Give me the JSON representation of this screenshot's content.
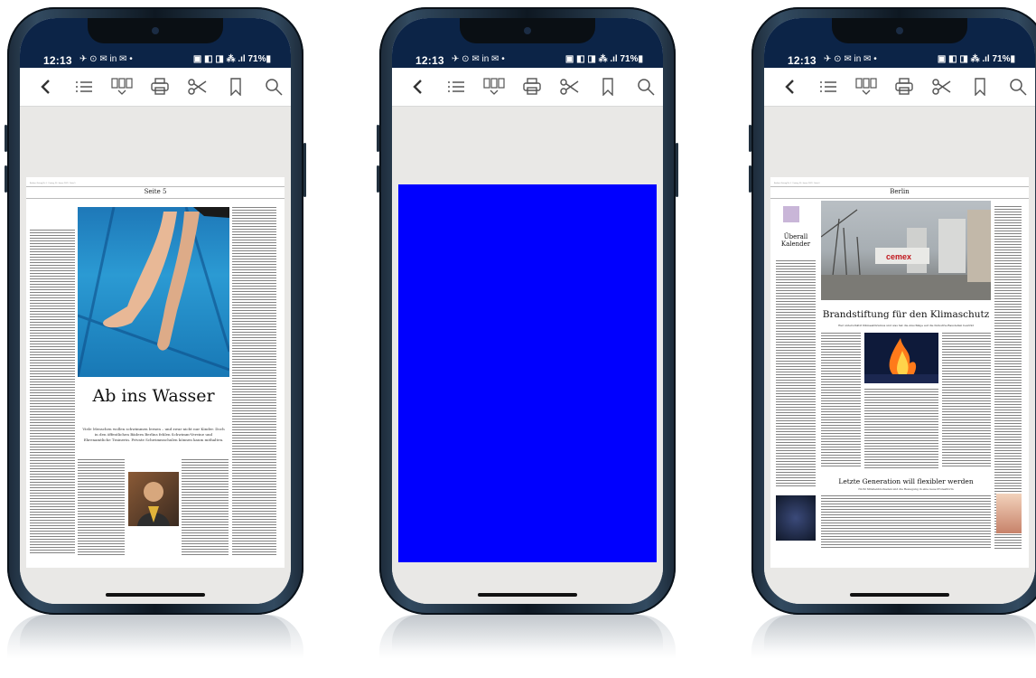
{
  "phones": [
    {
      "status": {
        "time": "12:13",
        "left_icons": "✈ ⊙ ✉ in ✉ •",
        "right_icons": "▣ ◧ ◨ ⁂ .ıl 71%▮"
      },
      "toolbar": [
        "back-icon",
        "list-icon",
        "columns-icon",
        "print-icon",
        "scissors-icon",
        "bookmark-icon",
        "search-icon"
      ],
      "page": {
        "header_line": "Berliner Zeitung Nr. 0 · Freitag, 30. Januar 2023 · Seite 5",
        "section": "Seite 5",
        "headline": "Ab ins Wasser",
        "subhead": "Viele Menschen wollen schwimmen lernen – und zwar nicht nur Kinder. Doch in den öffentlichen Bädern Berlins fehlen Schwimm-Vereine und Ehrenamtliche Trainerin. Private Schwimmschulen können kaum mithalten."
      }
    },
    {
      "status": {
        "time": "12:13",
        "left_icons": "✈ ⊙ ✉ in ✉ •",
        "right_icons": "▣ ◧ ◨ ⁂ .ıl 71%▮"
      },
      "toolbar": [
        "back-icon",
        "list-icon",
        "columns-icon",
        "print-icon",
        "scissors-icon",
        "bookmark-icon",
        "search-icon"
      ],
      "page": {
        "placeholder_color": "#0000ff"
      }
    },
    {
      "status": {
        "time": "12:13",
        "left_icons": "✈ ⊙ ✉ in ✉ •",
        "right_icons": "▣ ◧ ◨ ⁂ .ıl 71%▮"
      },
      "toolbar": [
        "back-icon",
        "list-icon",
        "columns-icon",
        "print-icon",
        "scissors-icon",
        "bookmark-icon",
        "search-icon"
      ],
      "page": {
        "header_line": "Berliner Zeitung Nr. 0 · Freitag, 30. Januar 2023 · Seite 6",
        "section": "Berlin",
        "side_headline": "Überall Kalender",
        "headline": "Brandstiftung für den Klimaschutz",
        "subhead": "Wer unterschätzt Klimaaktivismus und was hat die Anschläge auf die Industrie-Baustellen bewirkt",
        "headline2": "Letzte Generation will flexibler werden",
        "subhead2": "Nicht Straßenblockaden und die Bewegung in eine neue Protestform"
      }
    }
  ]
}
